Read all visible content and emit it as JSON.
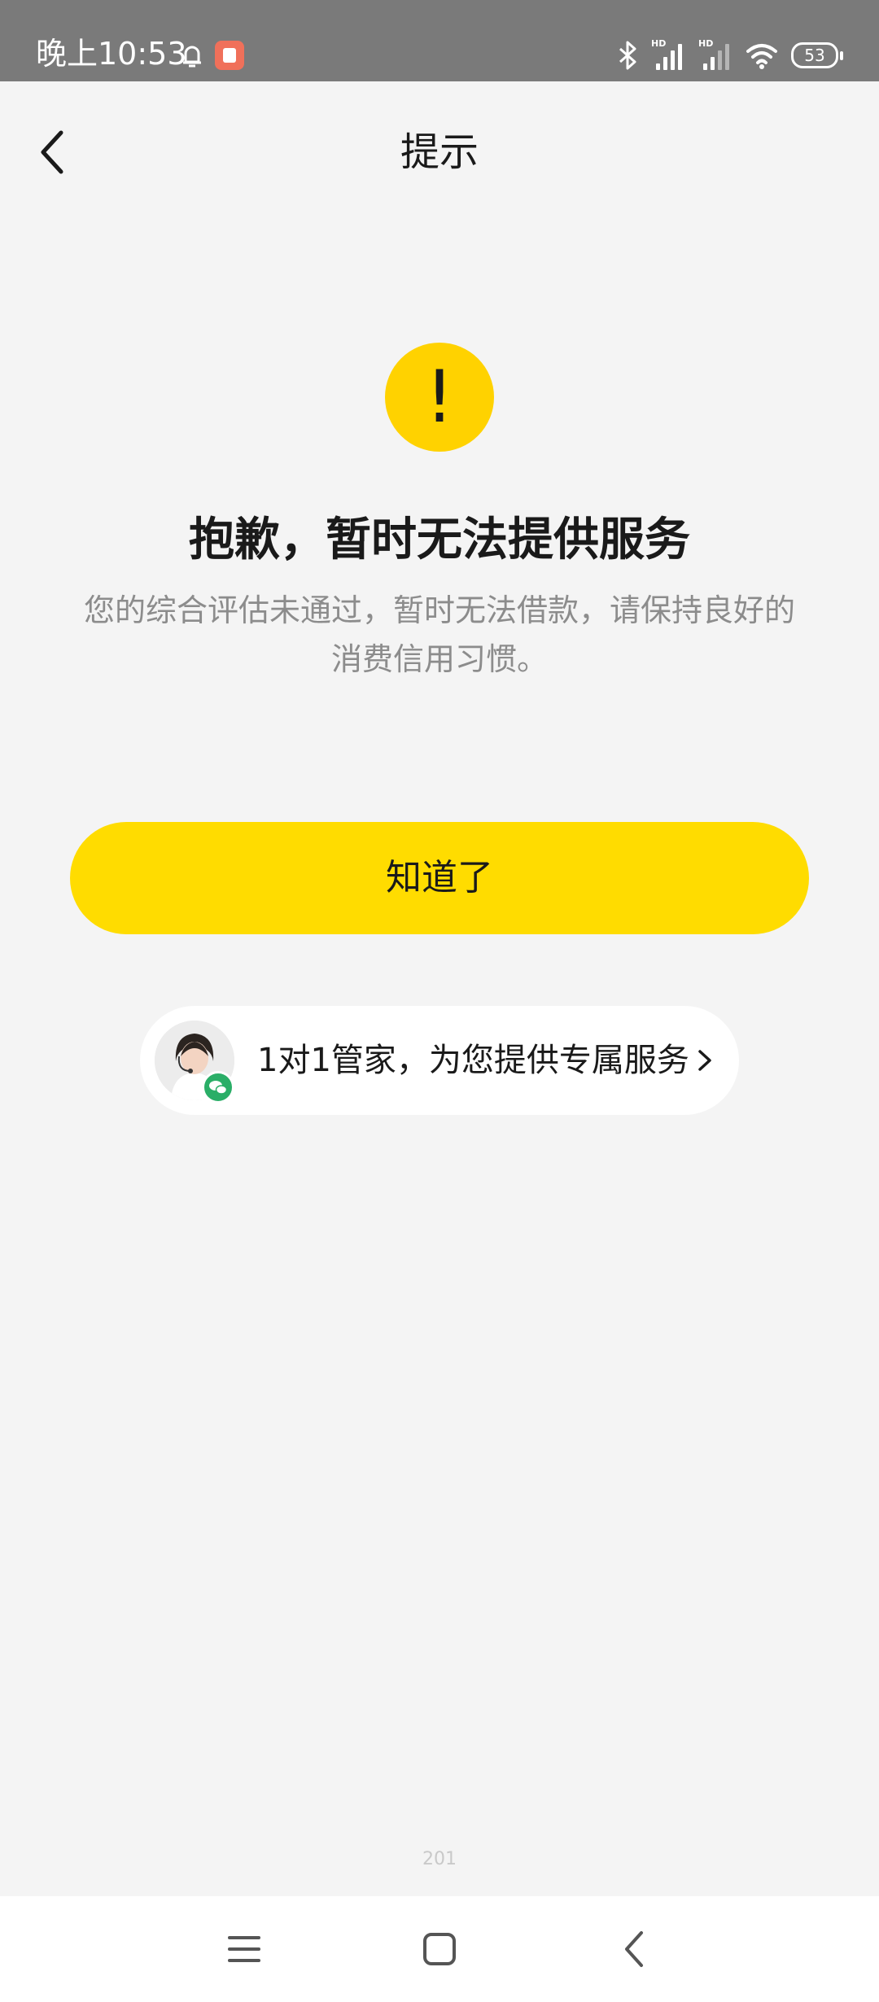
{
  "status_bar": {
    "time": "晚上10:53",
    "battery": "53",
    "icons": [
      "alarm-icon",
      "app-notification-icon",
      "bluetooth-icon",
      "hd-signal-icon",
      "hd-signal-icon",
      "wifi-icon",
      "battery-icon"
    ]
  },
  "nav": {
    "title": "提示",
    "back_icon": "chevron-left-icon"
  },
  "result": {
    "icon_symbol": "!",
    "title": "抱歉，暂时无法提供服务",
    "description": "您的综合评估未通过，暂时无法借款，请保持良好的消费信用习惯。"
  },
  "confirm_button": {
    "label": "知道了"
  },
  "service_banner": {
    "text": "1对1管家，为您提供专属服务",
    "icons": [
      "avatar",
      "wechat-icon",
      "chevron-right-icon"
    ]
  },
  "footer": {
    "version": "201"
  },
  "system_nav": {
    "icons": [
      "menu-icon",
      "home-icon",
      "back-icon"
    ]
  },
  "colors": {
    "accent": "#ffdc00",
    "warning": "#ffd200",
    "background": "#f4f4f4",
    "status_bar": "#7a7a7a",
    "wechat": "#2aae67"
  }
}
